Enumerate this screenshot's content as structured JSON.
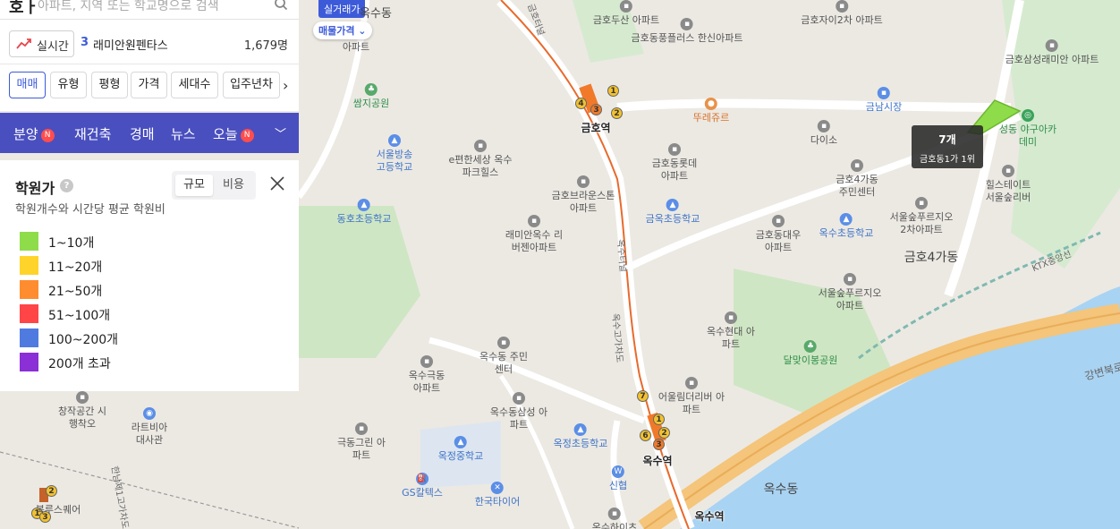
{
  "search": {
    "brand": "호ㅏ",
    "placeholder": "아파트, 지역 또는 학교명으로 검색"
  },
  "ranking": {
    "live_label": "실시간",
    "rank": "3",
    "name": "래미안원펜타스",
    "count": "1,679명"
  },
  "filters": {
    "items": [
      "매매",
      "유형",
      "평형",
      "가격",
      "세대수",
      "입주년차"
    ],
    "active": "매매"
  },
  "nav": {
    "items": [
      "분양",
      "재건축",
      "경매",
      "뉴스",
      "오늘"
    ],
    "badge": "N"
  },
  "legend": {
    "title": "학원가",
    "subtitle": "학원개수와 시간당 평균 학원비",
    "toggle": [
      "규모",
      "비용"
    ],
    "toggle_selected": "규모",
    "bins": [
      {
        "label": "1~10개",
        "color": "#8fdc4a"
      },
      {
        "label": "11~20개",
        "color": "#ffd42a"
      },
      {
        "label": "21~50개",
        "color": "#ff8c2e"
      },
      {
        "label": "51~100개",
        "color": "#ff4545"
      },
      {
        "label": "100~200개",
        "color": "#4f7be0"
      },
      {
        "label": "200개 초과",
        "color": "#8b2fd6"
      }
    ]
  },
  "map": {
    "chip_deal": "실거래가",
    "chip_price": "매물가격 ⌄",
    "tooltip": {
      "count": "7개",
      "rank": "금호동1가 1위"
    },
    "dongs": [
      "옥수동",
      "금호4가동",
      "옥수동"
    ],
    "stations": [
      "금호역",
      "옥수역",
      "옥수역"
    ],
    "roads": [
      "KTX중앙선",
      "강변북로",
      "한남제1고가차도",
      "옥수고가차도",
      "옥수터널",
      "금호터널"
    ],
    "places": [
      "금호두산 아파트",
      "금호자이2차 아파트",
      "금호동풍플러스 한신아파트",
      "금호삼성래미안 아파트",
      "쌈지공원",
      "뚜레쥬르",
      "금남시장",
      "다이소",
      "성동 야구아카데미",
      "서울방송 고등학교",
      "e편한세상 옥수파크힐스",
      "금호동롯데 아파트",
      "금호4가동 주민센터",
      "힐스테이트 서울숲리버",
      "금호브라운스톤 아파트",
      "동호초등학교",
      "금옥초등학교",
      "래미안옥수 리버젠아파트",
      "금호동대우 아파트",
      "옥수초등학교",
      "서울숲푸르지오 2차아파트",
      "서울숲푸르지오 아파트",
      "옥수현대 아파트",
      "달맞이봉공원",
      "옥수동 주민센터",
      "옥수극동 아파트",
      "어울림더리버 아파트",
      "옥수동삼성 아파트",
      "옥정초등학교",
      "창작공간 시행착오",
      "라트비아 대사관",
      "극동그린 아파트",
      "옥정중학교",
      "신협",
      "GS칼텍스",
      "한국타이어",
      "옥수하이츠",
      "북루스퀘어",
      "아파트"
    ]
  }
}
